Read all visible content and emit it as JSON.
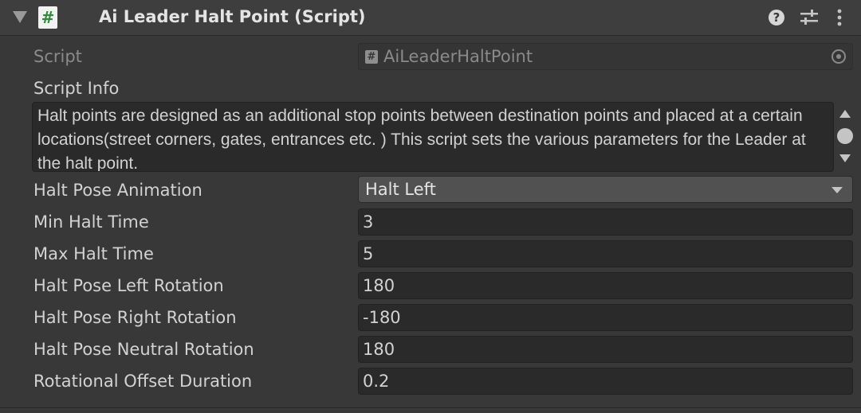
{
  "component": {
    "title": "Ai Leader Halt Point (Script)",
    "icon_glyph": "#",
    "icons": [
      "foldout-arrow-icon",
      "script-icon",
      "help-icon",
      "presets-icon",
      "kebab-menu-icon"
    ]
  },
  "script": {
    "label": "Script",
    "value": "AiLeaderHaltPoint",
    "mini_icon": "#"
  },
  "script_info": {
    "label": "Script Info",
    "text": "Halt points are designed as an additional stop points between destination points and placed at a certain locations(street corners, gates, entrances etc. ) This script sets the various parameters for the Leader at the halt point."
  },
  "help": {
    "glyph": "?"
  },
  "fields": [
    {
      "label": "Halt Pose Animation",
      "value": "Halt Left",
      "type": "dropdown"
    },
    {
      "label": "Min Halt Time",
      "value": "3"
    },
    {
      "label": "Max Halt Time",
      "value": "5"
    },
    {
      "label": "Halt Pose Left Rotation",
      "value": "180"
    },
    {
      "label": "Halt Pose Right Rotation",
      "value": "-180"
    },
    {
      "label": "Halt Pose Neutral Rotation",
      "value": "180"
    },
    {
      "label": "Rotational Offset Duration",
      "value": "0.2"
    }
  ],
  "colors": {
    "background": "#383838",
    "header": "#3e3e3e",
    "field": "#2a2a2a",
    "dropdown": "#515151",
    "text": "#d2d2d2",
    "script_icon_green": "#2f8a3a"
  }
}
